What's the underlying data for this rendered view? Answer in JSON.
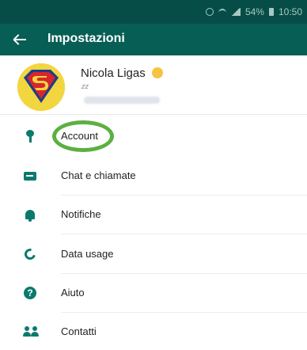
{
  "status_bar": {
    "battery": "54%",
    "time": "10:50"
  },
  "app_bar": {
    "title": "Impostazioni"
  },
  "profile": {
    "name": "Nicola Ligas",
    "status_glyph": "zz"
  },
  "menu": {
    "items": [
      {
        "label": "Account",
        "icon": "key-icon"
      },
      {
        "label": "Chat e chiamate",
        "icon": "chat-icon"
      },
      {
        "label": "Notifiche",
        "icon": "bell-icon"
      },
      {
        "label": "Data usage",
        "icon": "data-usage-icon"
      },
      {
        "label": "Aiuto",
        "icon": "help-icon"
      },
      {
        "label": "Contatti",
        "icon": "contacts-icon"
      }
    ]
  },
  "colors": {
    "app_bar": "#075e54",
    "status_bar": "#064d47",
    "accent": "#0b7a6e",
    "highlight": "#5cb040"
  }
}
